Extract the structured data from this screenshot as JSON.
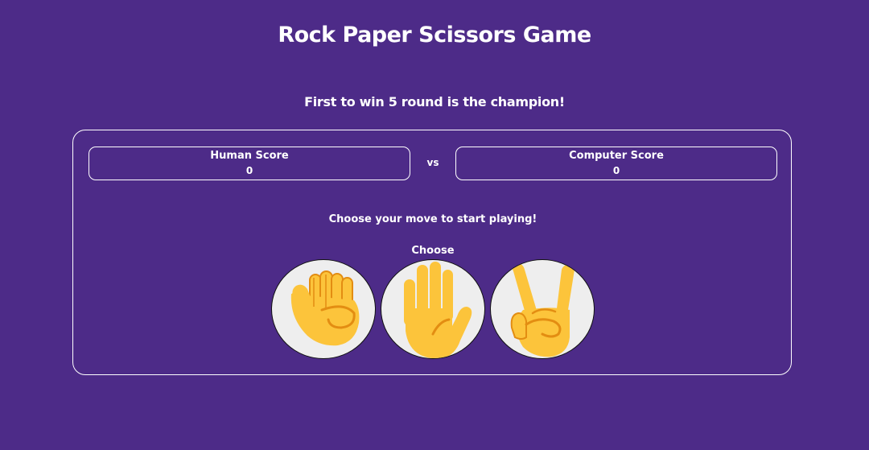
{
  "header": {
    "title": "Rock Paper Scissors Game",
    "subtitle": "First to win 5 round is the champion!"
  },
  "scoreboard": {
    "human_label": "Human Score",
    "human_score": "0",
    "vs_label": "vs",
    "computer_label": "Computer Score",
    "computer_score": "0"
  },
  "status_message": "Choose your move to start playing!",
  "choose_label": "Choose",
  "moves": [
    {
      "name": "rock",
      "icon": "raised-fist-icon"
    },
    {
      "name": "paper",
      "icon": "raised-hand-icon"
    },
    {
      "name": "scissors",
      "icon": "victory-hand-icon"
    }
  ],
  "colors": {
    "background": "#4d2b88",
    "text": "#ffffff",
    "button_bg": "#eeeeee",
    "hand_fill": "#fcc43b",
    "hand_line": "#e38d12"
  }
}
